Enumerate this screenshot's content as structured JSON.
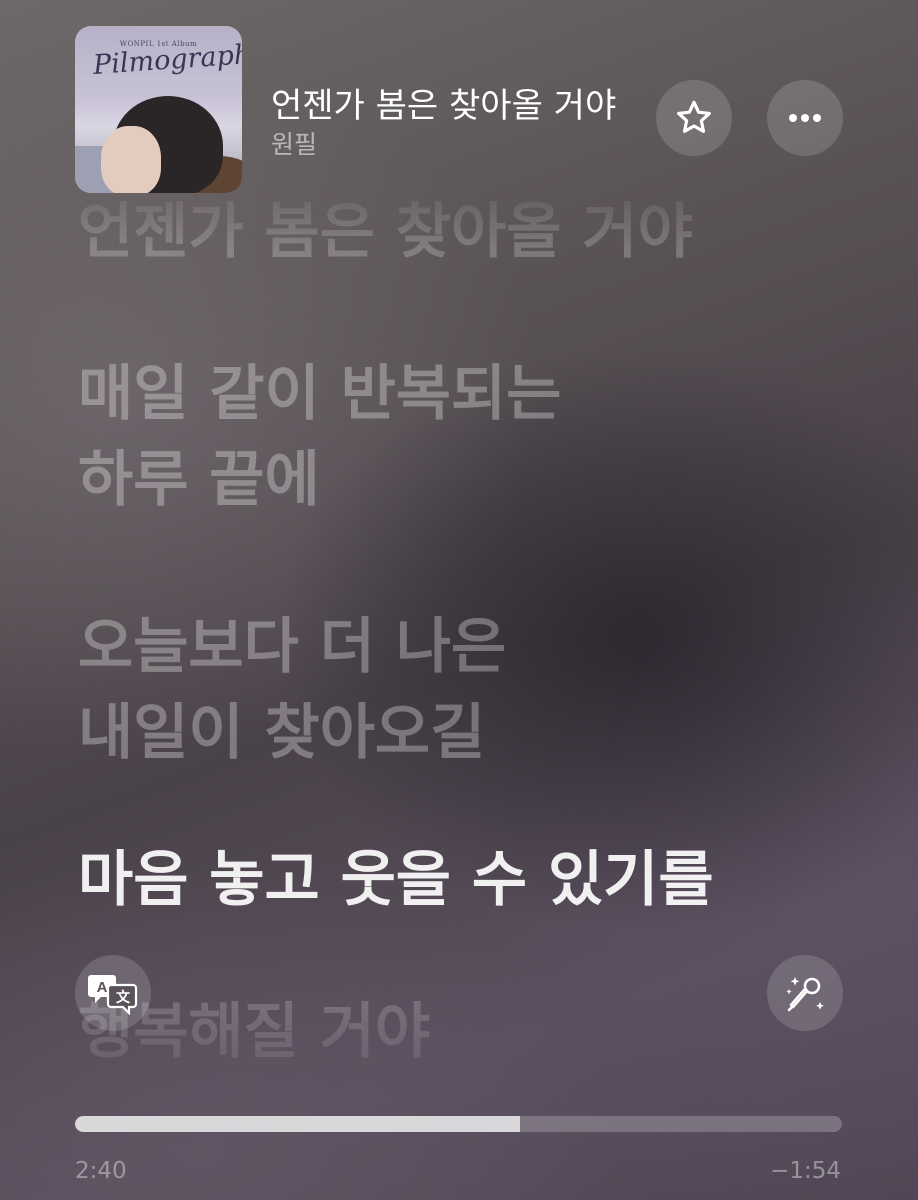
{
  "album": {
    "art_label": "album-cover",
    "art_title": "Pilmography",
    "art_small": "WONPIL 1st Album"
  },
  "now_playing": {
    "title": "언젠가 봄은 찾아올 거야",
    "artist": "원필"
  },
  "actions": {
    "favorite_icon": "star-icon",
    "more_icon": "ellipsis-icon"
  },
  "lyrics": {
    "faded_top": "언젠가 봄은 찾아올 거야",
    "line1a": "매일 같이 반복되는",
    "line1b": "하루 끝에",
    "line2a": "오늘보다 더 나은",
    "line2b": "내일이 찾아오길",
    "active": "마음 놓고 웃을 수 있기를",
    "faded_bottom": "행복해질 거야"
  },
  "controls": {
    "translate_icon": "translate-icon",
    "sing_icon": "microphone-sparkle-icon"
  },
  "playback": {
    "elapsed": "2:40",
    "remaining": "−1:54",
    "progress": 0.58
  }
}
